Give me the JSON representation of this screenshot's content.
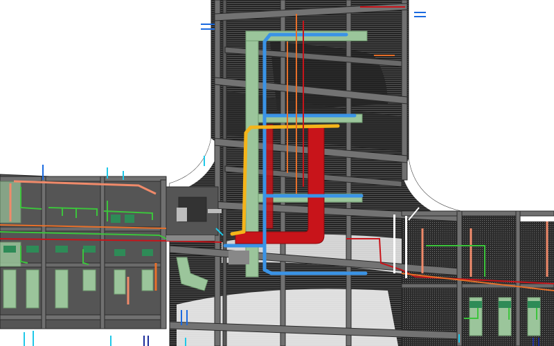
{
  "view": {
    "background": "#ffffff"
  },
  "palette": {
    "slab": "#3d3d3d",
    "slab_light": "#5a5a5a",
    "hatch": "#1a1a1a",
    "beam": "#6e6e6e",
    "beam_edge": "#2a2a2a",
    "duct_green": "#9bc59b",
    "duct_green_dark": "#2e8b57",
    "pipe_blue": "#3a93e6",
    "pipe_yellow": "#f4b41a",
    "duct_red": "#c8141a",
    "pipe_orange": "#e8702a",
    "pipe_salmon": "#f08a6a",
    "pipe_green": "#3cc43c",
    "accent_cyan": "#1ec8e8",
    "accent_navy": "#1a2a9a"
  },
  "layers": [
    {
      "name": "structural-slab",
      "color_key": "slab"
    },
    {
      "name": "structural-beams",
      "color_key": "beam"
    },
    {
      "name": "supply-duct",
      "color_key": "duct_green"
    },
    {
      "name": "chilled-water-pipe",
      "color_key": "pipe_blue"
    },
    {
      "name": "hot-water-pipe",
      "color_key": "pipe_yellow"
    },
    {
      "name": "exhaust-duct",
      "color_key": "duct_red"
    },
    {
      "name": "fire-sprinkler-pipe",
      "color_key": "pipe_orange"
    },
    {
      "name": "drain-pipe",
      "color_key": "pipe_green"
    }
  ]
}
